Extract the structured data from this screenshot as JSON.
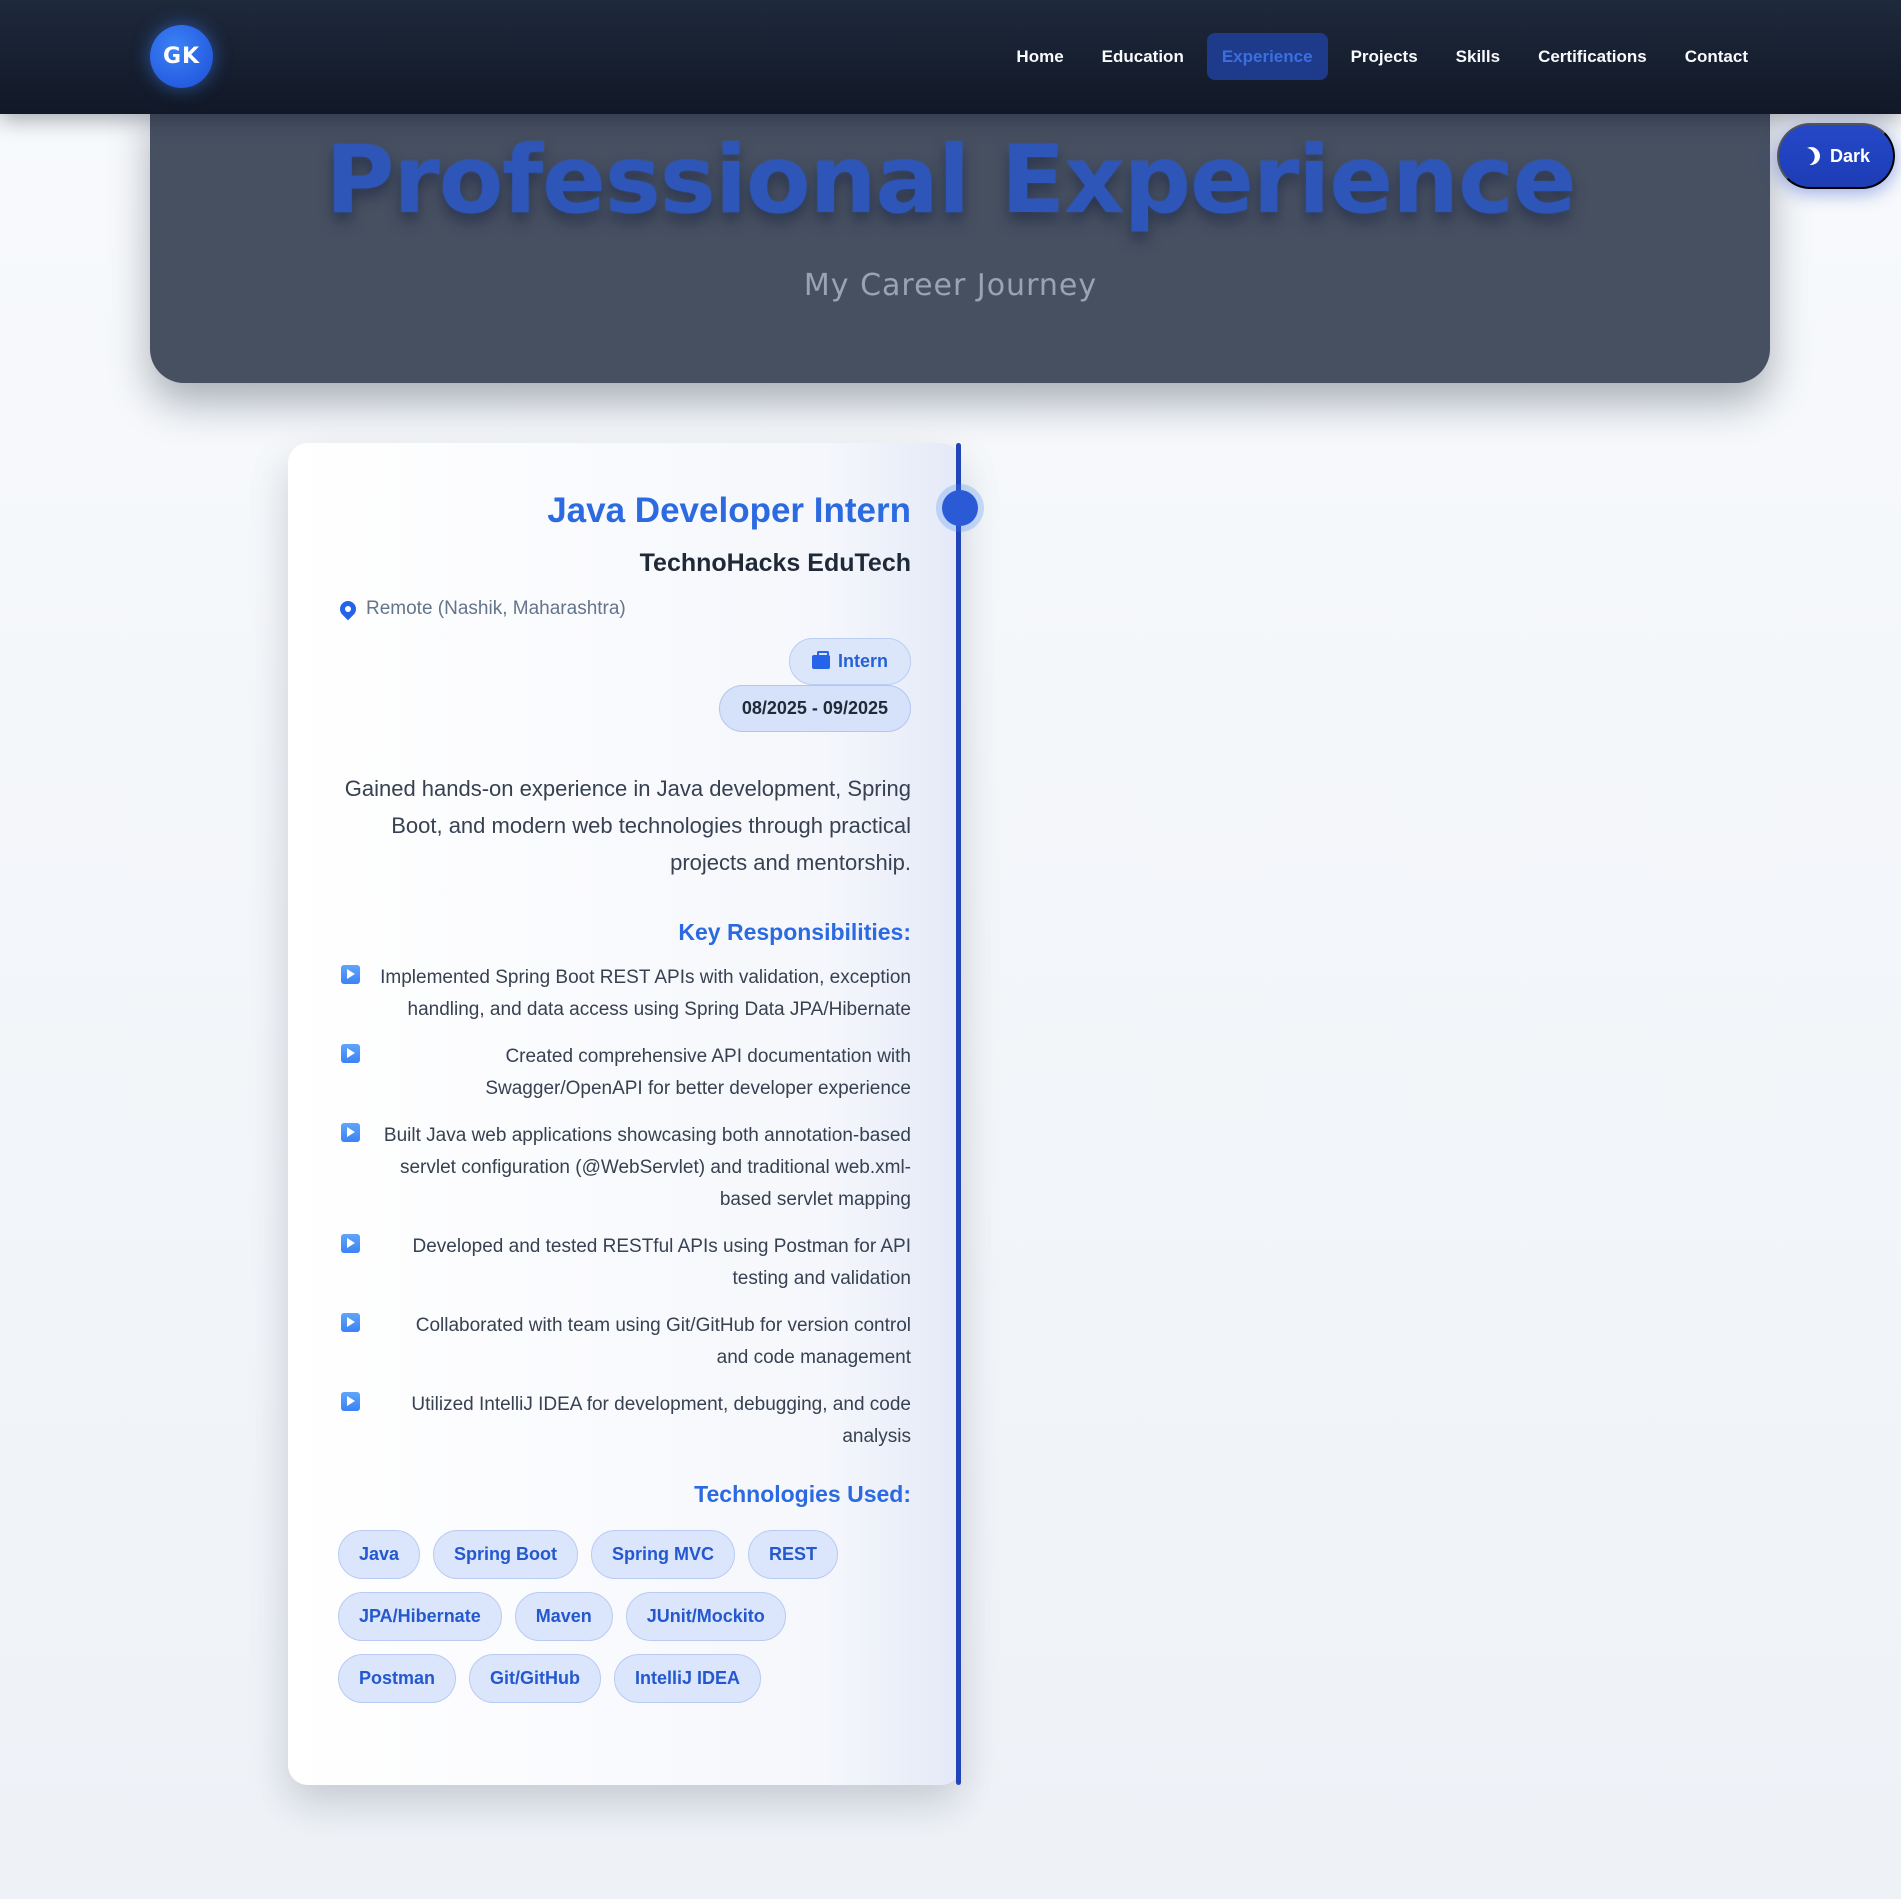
{
  "nav": {
    "logo": "GK",
    "links": [
      "Home",
      "Education",
      "Experience",
      "Projects",
      "Skills",
      "Certifications",
      "Contact"
    ],
    "active": "Experience"
  },
  "theme_toggle": {
    "label": "Dark",
    "icon": "moon-icon"
  },
  "hero": {
    "title": "Professional Experience",
    "subtitle": "My Career Journey"
  },
  "experience": {
    "title": "Java Developer Intern",
    "company": "TechnoHacks EduTech",
    "location": "Remote (Nashik, Maharashtra)",
    "type": "Intern",
    "dates": "08/2025 - 09/2025",
    "summary": "Gained hands-on experience in Java development, Spring Boot, and modern web technologies through practical projects and mentorship.",
    "responsibilities_heading": "Key Responsibilities:",
    "responsibilities": [
      "Implemented Spring Boot REST APIs with validation, exception handling, and data access using Spring Data JPA/Hibernate",
      "Created comprehensive API documentation with Swagger/OpenAPI for better developer experience",
      "Built Java web applications showcasing both annotation-based servlet configuration (@WebServlet) and traditional web.xml-based servlet mapping",
      "Developed and tested RESTful APIs using Postman for API testing and validation",
      "Collaborated with team using Git/GitHub for version control and code management",
      "Utilized IntelliJ IDEA for development, debugging, and code analysis"
    ],
    "tech_heading": "Technologies Used:",
    "technologies": [
      "Java",
      "Spring Boot",
      "Spring MVC",
      "REST",
      "JPA/Hibernate",
      "Maven",
      "JUnit/Mockito",
      "Postman",
      "Git/GitHub",
      "IntelliJ IDEA"
    ]
  },
  "colors": {
    "accent": "#2b6ae0",
    "nav_bg": "#1e293b",
    "hero_bg": "#475061",
    "toggle_bg": "#2548c9"
  }
}
